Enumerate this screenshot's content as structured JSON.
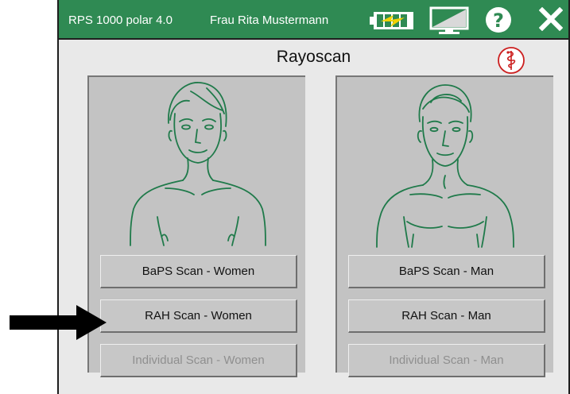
{
  "topbar": {
    "app_title": "RPS 1000 polar 4.0",
    "user_name": "Frau Rita Mustermann",
    "icons": [
      "battery-charging-icon",
      "display-brightness-icon",
      "help-icon",
      "close-icon"
    ],
    "color": "#2f8a53"
  },
  "main": {
    "heading": "Rayoscan",
    "logo_icon": "caduceus-icon",
    "panels": [
      {
        "figure": "woman-outline-icon",
        "buttons": [
          {
            "label": "BaPS Scan - Women",
            "enabled": true
          },
          {
            "label": "RAH Scan - Women",
            "enabled": true
          },
          {
            "label": "Individual Scan - Women",
            "enabled": false
          }
        ]
      },
      {
        "figure": "man-outline-icon",
        "buttons": [
          {
            "label": "BaPS Scan - Man",
            "enabled": true
          },
          {
            "label": "RAH Scan - Man",
            "enabled": true
          },
          {
            "label": "Individual Scan - Man",
            "enabled": false
          }
        ]
      }
    ]
  },
  "annotation": {
    "icon": "arrow-right-icon",
    "color": "#000000"
  },
  "colors": {
    "figure_stroke": "#1f7a4a",
    "panel_bg": "#c3c3c3",
    "disabled_text": "#8f8f8f"
  }
}
